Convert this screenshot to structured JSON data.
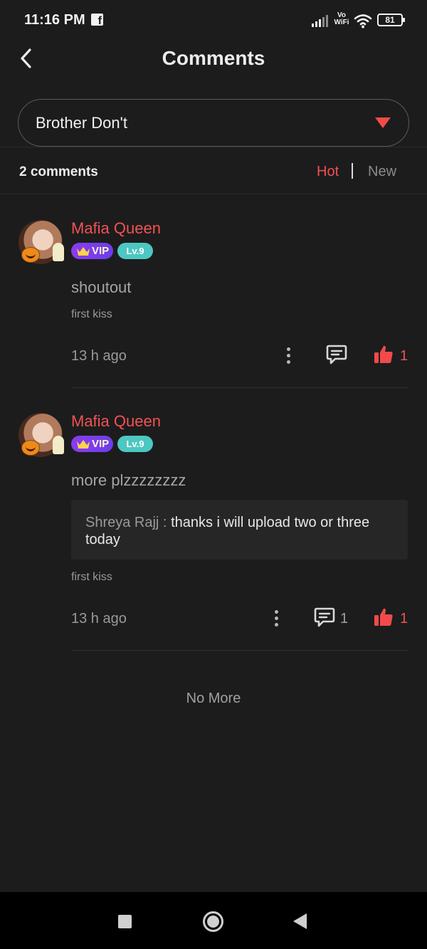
{
  "status_bar": {
    "time": "11:16 PM",
    "facebook_glyph": "f",
    "network_label": "Vo WiFi",
    "battery_level": "81"
  },
  "header": {
    "title": "Comments"
  },
  "book_selector": {
    "selected": "Brother Don't"
  },
  "summary": {
    "count_label": "2 comments",
    "sort_hot": "Hot",
    "sort_new": "New",
    "active_sort": "Hot"
  },
  "comments": [
    {
      "username": "Mafia Queen",
      "vip": "VIP",
      "level": "Lv.9",
      "text": "shoutout",
      "book": "first kiss",
      "time": "13 h ago",
      "replies": "",
      "likes": "1"
    },
    {
      "username": "Mafia Queen",
      "vip": "VIP",
      "level": "Lv.9",
      "text": "more plzzzzzzzz",
      "reply_author": "Shreya Rajj : ",
      "reply_text": "thanks i will upload two or three today",
      "book": "first kiss",
      "time": "13 h ago",
      "replies": "1",
      "likes": "1"
    }
  ],
  "footer": {
    "no_more": "No More"
  },
  "colors": {
    "background": "#1c1c1d",
    "accent": "#f25252",
    "vip": "#7b3cf0",
    "level": "#4dc7c2"
  }
}
